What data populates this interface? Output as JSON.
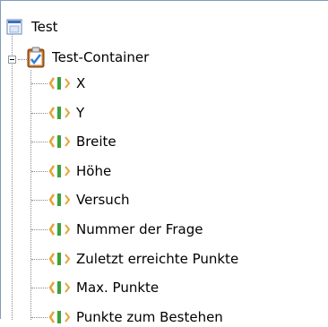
{
  "tree": {
    "root": {
      "label": "Test",
      "icon": "window-icon"
    },
    "container": {
      "label": "Test-Container",
      "icon": "clipboard-checklist-icon",
      "expanded": true
    },
    "variables": [
      {
        "label": "X",
        "icon": "variable-icon"
      },
      {
        "label": "Y",
        "icon": "variable-icon"
      },
      {
        "label": "Breite",
        "icon": "variable-icon"
      },
      {
        "label": "Höhe",
        "icon": "variable-icon"
      },
      {
        "label": "Versuch",
        "icon": "variable-icon"
      },
      {
        "label": "Nummer der Frage",
        "icon": "variable-icon"
      },
      {
        "label": "Zuletzt erreichte Punkte",
        "icon": "variable-icon"
      },
      {
        "label": "Max. Punkte",
        "icon": "variable-icon"
      },
      {
        "label": "Punkte zum Bestehen",
        "icon": "variable-icon"
      }
    ]
  },
  "colors": {
    "tree_line": "#8a8a8a",
    "variable_brace": "#e6a33a",
    "variable_bar": "#3aa13a",
    "window_blue": "#3a6fc4",
    "clipboard_brown": "#b5651d"
  }
}
